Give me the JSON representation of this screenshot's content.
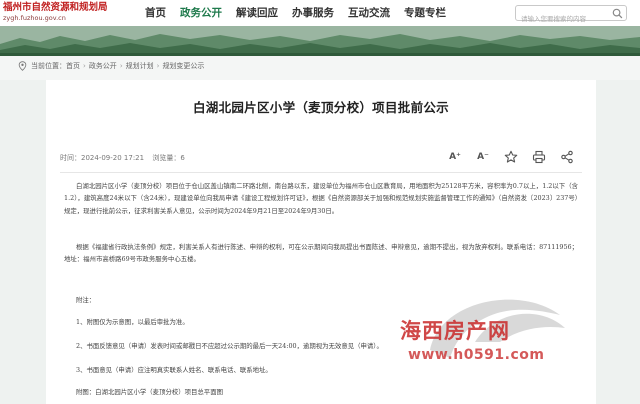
{
  "site": {
    "name": "福州市自然资源和规划局",
    "url": "zygh.fuzhou.gov.cn"
  },
  "nav": {
    "items": [
      {
        "label": "首页"
      },
      {
        "label": "政务公开"
      },
      {
        "label": "解读回应"
      },
      {
        "label": "办事服务"
      },
      {
        "label": "互动交流"
      },
      {
        "label": "专题专栏"
      }
    ],
    "active_color": "#1f7a4c"
  },
  "search": {
    "placeholder": "请输入您要搜索的内容"
  },
  "breadcrumb": {
    "prefix": "当前位置：",
    "items": [
      "首页",
      "政务公开",
      "规划计划",
      "规划变更公示"
    ]
  },
  "article": {
    "title": "白湖北园片区小学（麦顶分校）项目批前公示",
    "time_label": "时间：",
    "time": "2024-09-20 17:21",
    "views_label": "浏览量：",
    "views": "6",
    "p1": "白湖北园片区小学（麦顶分校）项目位于仓山区盖山镇南二环路北侧，南台路以东，建设单位为福州市仓山区教育局，用地面积为25128平方米，容积率为0.7以上，1.2以下（含1.2），建筑高度24米以下（含24米），现建设单位向我局申请《建设工程规划许可证》，根据《自然资源部关于加强和规范规划实施监督管理工作的通知》（自然资发〔2023〕237号）规定，现进行批前公示，征求利害关系人意见，公示时间为2024年9月21日至2024年9月30日。",
    "p2": "根据《福建省行政执法条例》规定，利害关系人有进行陈述、申辩的权利，可在公示期间向我局提出书面陈述、申辩意见，逾期不提出，视为放弃权利。联系电话：87111956；地址：福州市高桥路69号市政务服务中心五楼。",
    "attach_title": "附注：",
    "att1": "1、附图仅为示意图，以最后审批为准。",
    "att2": "2、书面反馈意见（申请）发表时间或邮戳日不应超过公示期的最后一天24:00，逾期视为无效意见（申请）。",
    "att3": "3、书面意见（申请）应注明真实联系人姓名、联系电话、联系地址。",
    "att_last": "附图：白湖北园片区小学（麦顶分校）项目总平面图"
  },
  "tools": {
    "font_increase": "A⁺",
    "font_decrease": "A⁻"
  },
  "watermark": {
    "name": "海西房产网",
    "url": "www.h0591.com"
  },
  "icons": {
    "search": "magnifier-icon",
    "location": "location-pin-icon",
    "star": "star-icon",
    "print": "printer-icon",
    "share": "share-icon"
  }
}
